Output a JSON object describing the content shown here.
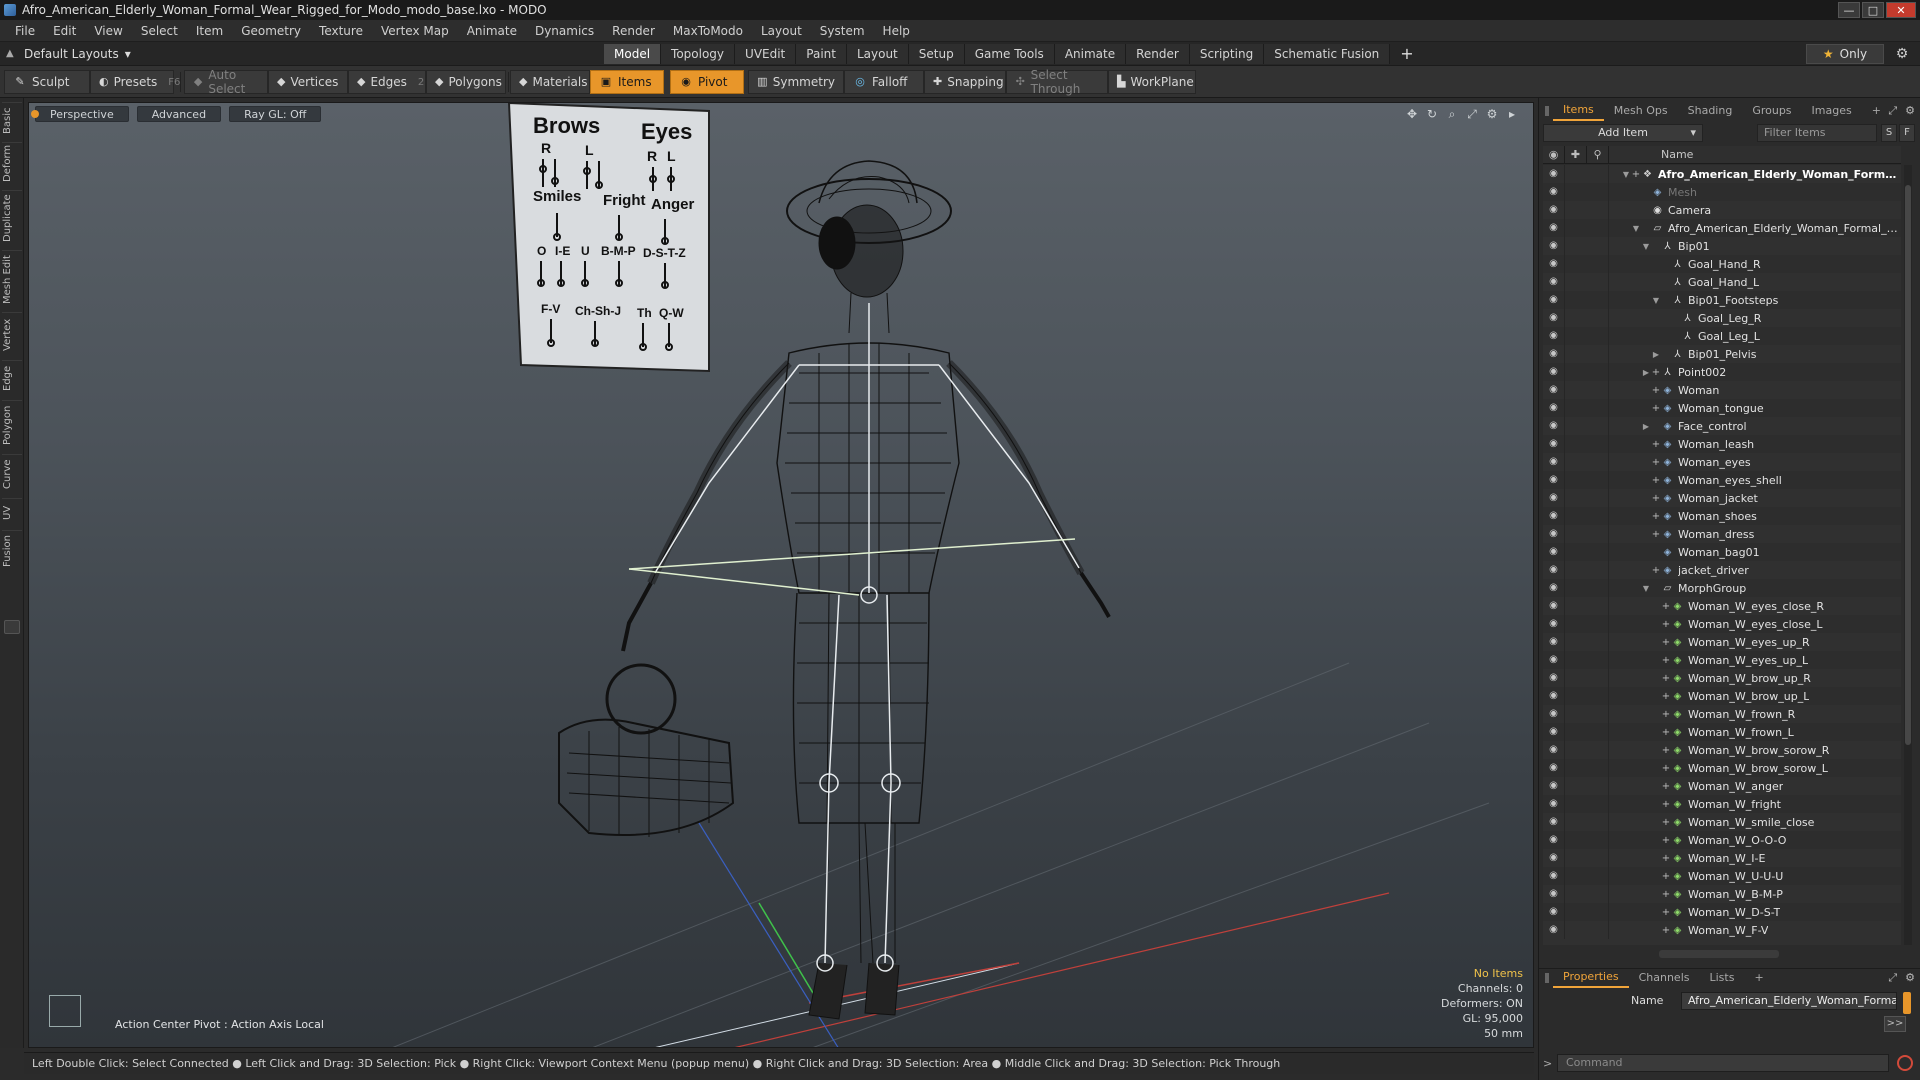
{
  "window": {
    "title": "Afro_American_Elderly_Woman_Formal_Wear_Rigged_for_Modo_modo_base.lxo - MODO",
    "minimize": "—",
    "maximize": "□",
    "close": "✕"
  },
  "menu": [
    "File",
    "Edit",
    "View",
    "Select",
    "Item",
    "Geometry",
    "Texture",
    "Vertex Map",
    "Animate",
    "Dynamics",
    "Render",
    "MaxToModo",
    "Layout",
    "System",
    "Help"
  ],
  "layout_bar": {
    "layout_select": "Default Layouts",
    "tabs": [
      "Model",
      "Topology",
      "UVEdit",
      "Paint",
      "Layout",
      "Setup",
      "Game Tools",
      "Animate",
      "Render",
      "Scripting",
      "Schematic Fusion"
    ],
    "active_tab": "Model",
    "plus": "+",
    "only_label": "Only"
  },
  "toolbar": {
    "sculpt": "Sculpt",
    "presets": "Presets",
    "presets_key": "F6",
    "auto_select": "Auto Select",
    "vertices": "Vertices",
    "vertices_key": "1",
    "edges": "Edges",
    "edges_key": "2",
    "polygons": "Polygons",
    "materials": "Materials",
    "items": "Items",
    "pivot": "Pivot",
    "symmetry": "Symmetry",
    "falloff": "Falloff",
    "snapping": "Snapping",
    "select_through": "Select Through",
    "workplane": "WorkPlane"
  },
  "left_tabs": [
    "Basic",
    "Deform",
    "Duplicate",
    "Mesh Edit",
    "Vertex",
    "Edge",
    "Polygon",
    "Curve",
    "UV",
    "Fusion"
  ],
  "viewport": {
    "view_mode": "Perspective",
    "shading": "Advanced",
    "raygl": "Ray GL: Off",
    "action_center": "Action Center Pivot : Action Axis Local",
    "info": {
      "no_items": "No Items",
      "channels": "Channels: 0",
      "deformers": "Deformers: ON",
      "gl": "GL: 95,000",
      "focal": "50 mm"
    },
    "board": {
      "brows": "Brows",
      "eyes": "Eyes",
      "r": "R",
      "l": "L",
      "smiles": "Smiles",
      "fright": "Fright",
      "anger": "Anger",
      "o": "O",
      "ie": "I-E",
      "u": "U",
      "bmp": "B-M-P",
      "dstz": "D-S-T-Z",
      "fv": "F-V",
      "chshj": "Ch-Sh-J",
      "th": "Th",
      "qw": "Q-W"
    }
  },
  "status_bar": "Left Double Click: Select Connected ● Left Click and Drag: 3D Selection: Pick ● Right Click: Viewport Context Menu (popup menu) ● Right Click and Drag: 3D Selection: Area ● Middle Click and Drag: 3D Selection: Pick Through",
  "items_panel": {
    "tabs": [
      "Items",
      "Mesh Ops",
      "Shading",
      "Groups",
      "Images"
    ],
    "active_tab": "Items",
    "plus": "+",
    "add_item": "Add Item",
    "filter_placeholder": "Filter Items",
    "s_btn": "S",
    "f_btn": "F",
    "name_header": "Name",
    "tree": [
      {
        "label": "Afro_American_Elderly_Woman_Formal_...",
        "depth": 0,
        "icon": "scene",
        "tw": "▼",
        "plus": "+",
        "root": true
      },
      {
        "label": "Mesh",
        "depth": 1,
        "icon": "mesh",
        "tw": "",
        "plus": "",
        "dim": true
      },
      {
        "label": "Camera",
        "depth": 1,
        "icon": "camera",
        "tw": "",
        "plus": ""
      },
      {
        "label": "Afro_American_Elderly_Woman_Formal_Wea...",
        "depth": 1,
        "icon": "group",
        "tw": "▼",
        "plus": ""
      },
      {
        "label": "Bip01",
        "depth": 2,
        "icon": "loc",
        "tw": "▼",
        "plus": ""
      },
      {
        "label": "Goal_Hand_R",
        "depth": 3,
        "icon": "loc",
        "tw": "",
        "plus": ""
      },
      {
        "label": "Goal_Hand_L",
        "depth": 3,
        "icon": "loc",
        "tw": "",
        "plus": ""
      },
      {
        "label": "Bip01_Footsteps",
        "depth": 3,
        "icon": "loc",
        "tw": "▼",
        "plus": ""
      },
      {
        "label": "Goal_Leg_R",
        "depth": 4,
        "icon": "loc",
        "tw": "",
        "plus": ""
      },
      {
        "label": "Goal_Leg_L",
        "depth": 4,
        "icon": "loc",
        "tw": "",
        "plus": ""
      },
      {
        "label": "Bip01_Pelvis",
        "depth": 3,
        "icon": "loc",
        "tw": "▶",
        "plus": ""
      },
      {
        "label": "Point002",
        "depth": 2,
        "icon": "loc",
        "tw": "▶",
        "plus": "+"
      },
      {
        "label": "Woman",
        "depth": 2,
        "icon": "mesh",
        "tw": "",
        "plus": "+"
      },
      {
        "label": "Woman_tongue",
        "depth": 2,
        "icon": "mesh",
        "tw": "",
        "plus": "+"
      },
      {
        "label": "Face_control",
        "depth": 2,
        "icon": "mesh",
        "tw": "▶",
        "plus": ""
      },
      {
        "label": "Woman_leash",
        "depth": 2,
        "icon": "mesh",
        "tw": "",
        "plus": "+"
      },
      {
        "label": "Woman_eyes",
        "depth": 2,
        "icon": "mesh",
        "tw": "",
        "plus": "+"
      },
      {
        "label": "Woman_eyes_shell",
        "depth": 2,
        "icon": "mesh",
        "tw": "",
        "plus": "+"
      },
      {
        "label": "Woman_jacket",
        "depth": 2,
        "icon": "mesh",
        "tw": "",
        "plus": "+"
      },
      {
        "label": "Woman_shoes",
        "depth": 2,
        "icon": "mesh",
        "tw": "",
        "plus": "+"
      },
      {
        "label": "Woman_dress",
        "depth": 2,
        "icon": "mesh",
        "tw": "",
        "plus": "+"
      },
      {
        "label": "Woman_bag01",
        "depth": 2,
        "icon": "mesh",
        "tw": "",
        "plus": ""
      },
      {
        "label": "jacket_driver",
        "depth": 2,
        "icon": "mesh",
        "tw": "",
        "plus": "+"
      },
      {
        "label": "MorphGroup",
        "depth": 2,
        "icon": "group",
        "tw": "▼",
        "plus": ""
      },
      {
        "label": "Woman_W_eyes_close_R",
        "depth": 3,
        "icon": "morph",
        "tw": "",
        "plus": "+"
      },
      {
        "label": "Woman_W_eyes_close_L",
        "depth": 3,
        "icon": "morph",
        "tw": "",
        "plus": "+"
      },
      {
        "label": "Woman_W_eyes_up_R",
        "depth": 3,
        "icon": "morph",
        "tw": "",
        "plus": "+"
      },
      {
        "label": "Woman_W_eyes_up_L",
        "depth": 3,
        "icon": "morph",
        "tw": "",
        "plus": "+"
      },
      {
        "label": "Woman_W_brow_up_R",
        "depth": 3,
        "icon": "morph",
        "tw": "",
        "plus": "+"
      },
      {
        "label": "Woman_W_brow_up_L",
        "depth": 3,
        "icon": "morph",
        "tw": "",
        "plus": "+"
      },
      {
        "label": "Woman_W_frown_R",
        "depth": 3,
        "icon": "morph",
        "tw": "",
        "plus": "+"
      },
      {
        "label": "Woman_W_frown_L",
        "depth": 3,
        "icon": "morph",
        "tw": "",
        "plus": "+"
      },
      {
        "label": "Woman_W_brow_sorow_R",
        "depth": 3,
        "icon": "morph",
        "tw": "",
        "plus": "+"
      },
      {
        "label": "Woman_W_brow_sorow_L",
        "depth": 3,
        "icon": "morph",
        "tw": "",
        "plus": "+"
      },
      {
        "label": "Woman_W_anger",
        "depth": 3,
        "icon": "morph",
        "tw": "",
        "plus": "+"
      },
      {
        "label": "Woman_W_fright",
        "depth": 3,
        "icon": "morph",
        "tw": "",
        "plus": "+"
      },
      {
        "label": "Woman_W_smile_close",
        "depth": 3,
        "icon": "morph",
        "tw": "",
        "plus": "+"
      },
      {
        "label": "Woman_W_O-O-O",
        "depth": 3,
        "icon": "morph",
        "tw": "",
        "plus": "+"
      },
      {
        "label": "Woman_W_I-E",
        "depth": 3,
        "icon": "morph",
        "tw": "",
        "plus": "+"
      },
      {
        "label": "Woman_W_U-U-U",
        "depth": 3,
        "icon": "morph",
        "tw": "",
        "plus": "+"
      },
      {
        "label": "Woman_W_B-M-P",
        "depth": 3,
        "icon": "morph",
        "tw": "",
        "plus": "+"
      },
      {
        "label": "Woman_W_D-S-T",
        "depth": 3,
        "icon": "morph",
        "tw": "",
        "plus": "+"
      },
      {
        "label": "Woman_W_F-V",
        "depth": 3,
        "icon": "morph",
        "tw": "",
        "plus": "+"
      }
    ]
  },
  "properties_panel": {
    "tabs": [
      "Properties",
      "Channels",
      "Lists"
    ],
    "active_tab": "Properties",
    "plus": "+",
    "name_label": "Name",
    "name_value": "Afro_American_Elderly_Woman_Formal_W",
    "arrow": ">>",
    "command_placeholder": "Command"
  },
  "colors": {
    "accent": "#e8962a",
    "active_tab_text": "#f0a43a",
    "morph_icon": "#8fdb6a"
  }
}
